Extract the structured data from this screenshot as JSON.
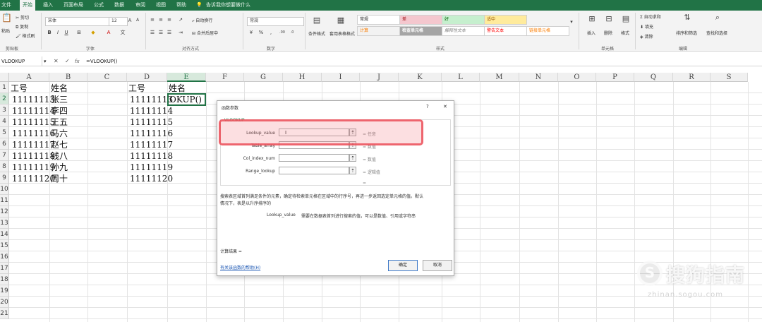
{
  "ribbon_tabs": [
    "文件",
    "开始",
    "插入",
    "页面布局",
    "公式",
    "数据",
    "审阅",
    "视图",
    "帮助",
    "告诉我你想要做什么"
  ],
  "clipboard": {
    "cut": "剪切",
    "copy": "复制",
    "format_painter": "格式刷",
    "paste": "粘贴",
    "label": "剪贴板"
  },
  "font": {
    "name": "宋体",
    "size": "12",
    "label": "字体"
  },
  "alignment": {
    "wrap": "自动换行",
    "merge": "合并后居中",
    "label": "对齐方式"
  },
  "number": {
    "format": "常规",
    "label": "数字"
  },
  "styles": {
    "conditional": "条件格式",
    "as_table": "套用表格格式",
    "label": "样式",
    "cells": [
      "常规",
      "差",
      "好",
      "适中",
      "计算",
      "检查单元格",
      "解释性文本",
      "警告文本",
      "链接单元格"
    ]
  },
  "cells_group": {
    "insert": "插入",
    "delete": "删除",
    "format": "格式",
    "label": "单元格"
  },
  "editing": {
    "autosum": "自动求和",
    "fill": "填充",
    "clear": "清除",
    "sort": "排序和筛选",
    "find": "查找和选择",
    "label": "编辑"
  },
  "formula_bar": {
    "name_box": "VLOOKUP",
    "cancel": "✕",
    "enter": "✓",
    "fx": "fx",
    "formula": "=VLOOKUP()"
  },
  "columns": [
    "A",
    "B",
    "C",
    "D",
    "E",
    "F",
    "G",
    "H",
    "I",
    "J",
    "K",
    "L",
    "M",
    "N",
    "O",
    "P",
    "Q",
    "R",
    "S"
  ],
  "rows": [
    "1",
    "2",
    "3",
    "4",
    "5",
    "6",
    "7",
    "8",
    "9",
    "10",
    "11",
    "12",
    "13",
    "14",
    "15",
    "16",
    "17",
    "18",
    "19",
    "20",
    "21"
  ],
  "sheet": {
    "headers": {
      "a": "工号",
      "b": "姓名",
      "d": "工号",
      "e": "姓名"
    },
    "a_values": [
      "11111113",
      "11111114",
      "11111115",
      "11111116",
      "11111117",
      "11111118",
      "11111119",
      "11111120"
    ],
    "b_values": [
      "张三",
      "李四",
      "王五",
      "马六",
      "赵七",
      "钱八",
      "孙九",
      "周十"
    ],
    "d_values": [
      "11111113",
      "11111114",
      "11111115",
      "11111116",
      "11111117",
      "11111118",
      "11111119",
      "11111120"
    ],
    "e_active": "OKUP()"
  },
  "dialog": {
    "title": "函数参数",
    "help_btn": "?",
    "close_btn": "✕",
    "function_name": "VLOOKUP",
    "args": [
      {
        "label": "Lookup_value",
        "value": "= 任意"
      },
      {
        "label": "Table_array",
        "value": "= 数值"
      },
      {
        "label": "Col_index_num",
        "value": "= 数值"
      },
      {
        "label": "Range_lookup",
        "value": "= 逻辑值"
      }
    ],
    "equals": "=",
    "description": "搜索表区域首列满足条件的元素，确定待检索单元格在区域中的行序号，再进一步返回选定单元格的值。默认",
    "description2": "情况下，表是以升序排序的",
    "arg_help_name": "Lookup_value",
    "arg_help": "需要在数据表首列进行搜索的值，可以是数值、引用或字符串",
    "result_label": "计算结果 =",
    "help_link": "有关该函数的帮助(H)",
    "ok": "确定",
    "cancel": "取消"
  },
  "watermark": {
    "logo": "S",
    "text": "搜狗指南",
    "url": "zhinan.sogou.com"
  }
}
